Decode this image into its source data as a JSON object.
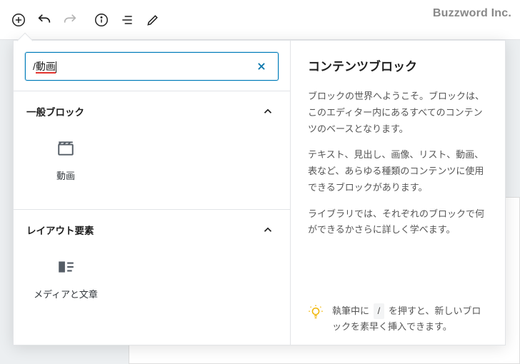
{
  "brand": "Buzzword Inc.",
  "toolbar": {
    "add": "add-block",
    "undo": "undo",
    "redo": "redo",
    "info": "info",
    "outline": "outline",
    "edit": "edit"
  },
  "inserter": {
    "search": {
      "value": "/動画",
      "display_prefix": "/",
      "display_term": "動画"
    },
    "categories": [
      {
        "id": "common",
        "label": "一般ブロック",
        "expanded": true,
        "blocks": [
          {
            "id": "video",
            "label": "動画"
          }
        ]
      },
      {
        "id": "layout",
        "label": "レイアウト要素",
        "expanded": true,
        "blocks": [
          {
            "id": "media-text",
            "label": "メディアと文章"
          }
        ]
      }
    ]
  },
  "sidebar": {
    "title": "コンテンツブロック",
    "paragraphs": [
      "ブロックの世界へようこそ。ブロックは、このエディター内にあるすべてのコンテンツのベースとなります。",
      "テキスト、見出し、画像、リスト、動画、表など、あらゆる種類のコンテンツに使用できるブロックがあります。",
      "ライブラリでは、それぞれのブロックで何ができるかさらに詳しく学べます。"
    ],
    "tip": {
      "pre": "執筆中に ",
      "key": "/",
      "post": " を押すと、新しいブロックを素早く挿入できます。"
    }
  }
}
